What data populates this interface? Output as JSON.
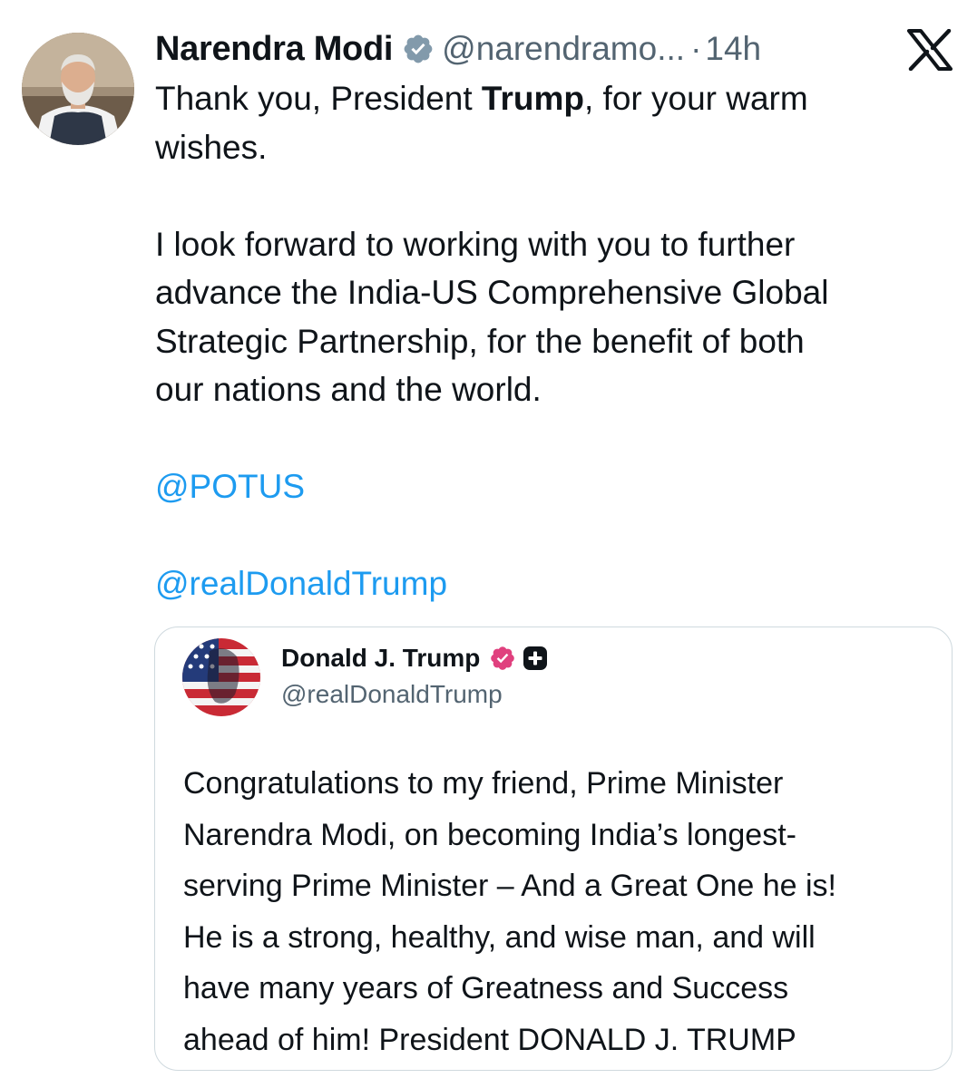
{
  "post": {
    "author_name": "Narendra Modi",
    "handle": "@narendramo...",
    "separator": "·",
    "time": "14h",
    "text_lines": {
      "line1_before": "Thank you, President ",
      "line1_bold": "Trump",
      "line1_after": ", for your warm",
      "line2": "wishes.",
      "para2_line1": "I look forward to working with you to further",
      "para2_line2": "advance the India-US Comprehensive Global",
      "para2_line3": "Strategic Partnership, for the benefit of both",
      "para2_line4": "our nations and the world."
    },
    "mentions": [
      "@POTUS",
      "@realDonaldTrump"
    ]
  },
  "quote": {
    "author_name": "Donald J. Trump",
    "handle": "@realDonaldTrump",
    "text_lines": [
      "Congratulations to my friend, Prime Minister",
      "Narendra Modi, on becoming India’s longest-",
      "serving Prime Minister – And a Great One he is!",
      "He is a strong, healthy, and wise man, and will",
      "have many years of Greatness and Success",
      "ahead of him! President DONALD J. TRUMP"
    ]
  },
  "icons": {
    "verified": "verified-badge-icon",
    "logo": "x-logo-icon",
    "quote_badge": "pink-verified-badge-icon",
    "quote_plus": "plus-square-icon"
  },
  "colors": {
    "text": "#0f1419",
    "secondary": "#536471",
    "mention": "#1d9bf0",
    "verified_badge": "#829aab",
    "quote_badge": "#e0407e",
    "border": "#cfd9de"
  }
}
